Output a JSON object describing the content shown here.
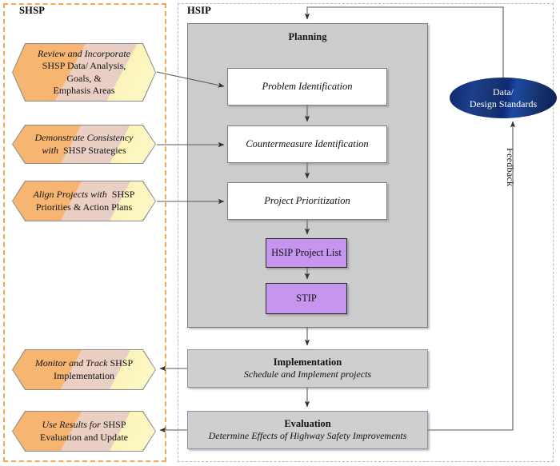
{
  "lanes": {
    "shsp_label": "SHSP",
    "hsip_label": "HSIP"
  },
  "planning": {
    "title": "Planning",
    "steps": [
      {
        "label": "Problem Identification"
      },
      {
        "label": "Countermeasure Identification"
      },
      {
        "label": "Project Prioritization"
      }
    ],
    "outputs": [
      {
        "label": "HSIP Project List"
      },
      {
        "label": "STIP"
      }
    ]
  },
  "stages": [
    {
      "title": "Implementation",
      "subtitle": "Schedule and Implement projects"
    },
    {
      "title": "Evaluation",
      "subtitle": "Determine Effects of Highway Safety Improvements"
    }
  ],
  "shsp_callouts": [
    {
      "line1": "Review and Incorporate",
      "line2": "SHSP Data/ Analysis,",
      "line3": "Goals, &",
      "line4": "Emphasis Areas"
    },
    {
      "line1": "Demonstrate Consistency",
      "line2": "with  SHSP Strategies"
    },
    {
      "line1": "Align Projects with  SHSP",
      "line2": "Priorities & Action Plans"
    },
    {
      "line1": "Monitor and Track SHSP",
      "line2": "Implementation"
    },
    {
      "line1": "Use Results for SHSP",
      "line2": "Evaluation and Update"
    }
  ],
  "data_node": {
    "line1": "Data/",
    "line2": "Design Standards"
  },
  "feedback": {
    "label": "Feedback"
  },
  "colors": {
    "shsp_lane_border": "#f2aa55",
    "hsip_lane_border": "#b8b8b8",
    "planning_fill": "#cccccc",
    "process_fill": "#ffffff",
    "purple_fill": "#c695f0",
    "stage_fill": "#cfcfcf",
    "stage_border": "#8a8fae",
    "hex_fill": "#f7b572",
    "oval_fill": "#11266b",
    "connector": "#555555"
  }
}
